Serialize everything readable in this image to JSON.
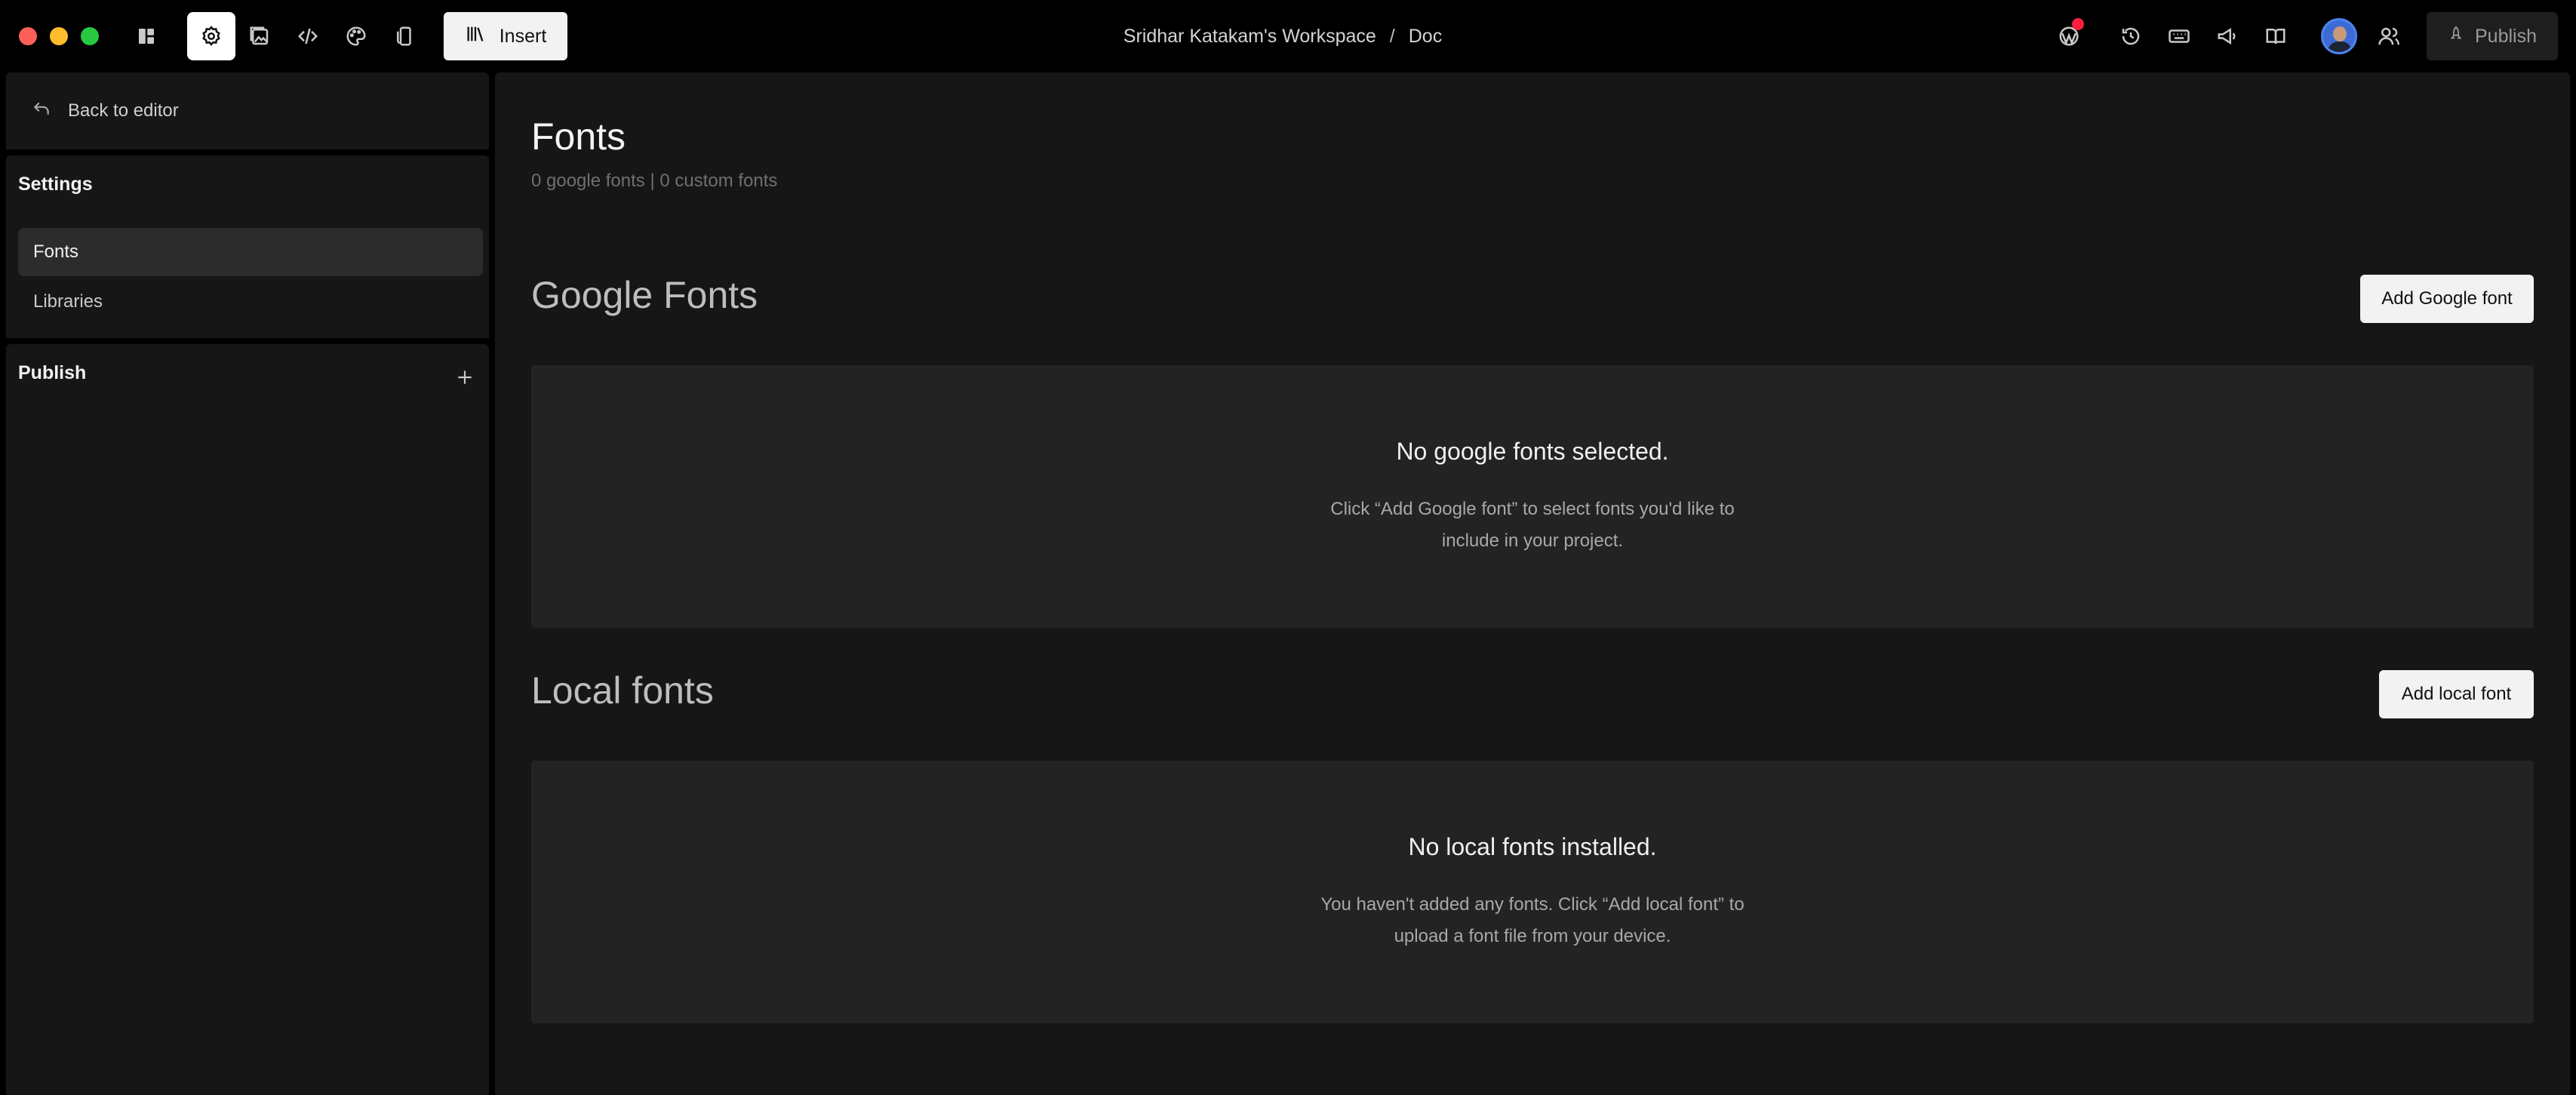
{
  "topbar": {
    "workspace": "Sridhar Katakam's Workspace",
    "separator": "/",
    "doc": "Doc",
    "insert_label": "Insert",
    "publish_label": "Publish",
    "left_icons": [
      "layout-icon",
      "settings-icon",
      "media-icon",
      "code-icon",
      "palette-icon",
      "responsive-icon"
    ],
    "right_icons": [
      "wordpress-icon",
      "history-icon",
      "keyboard-icon",
      "announcement-icon",
      "docs-icon",
      "avatar",
      "users-icon"
    ],
    "notification_color": "#ff1f3d"
  },
  "sidebar": {
    "back_label": "Back to editor",
    "settings_title": "Settings",
    "items": [
      {
        "label": "Fonts",
        "active": true
      },
      {
        "label": "Libraries",
        "active": false
      }
    ],
    "publish_title": "Publish"
  },
  "main": {
    "title": "Fonts",
    "subtitle": "0 google fonts | 0 custom fonts",
    "google": {
      "title": "Google Fonts",
      "button": "Add Google font",
      "empty_title": "No google fonts selected.",
      "empty_line1": "Click “Add Google font” to select fonts you'd like to",
      "empty_line2": "include in your project."
    },
    "local": {
      "title": "Local fonts",
      "button": "Add local font",
      "empty_title": "No local fonts installed.",
      "empty_line1": "You haven't added any fonts. Click “Add local font” to",
      "empty_line2": "upload a font file from your device."
    }
  }
}
